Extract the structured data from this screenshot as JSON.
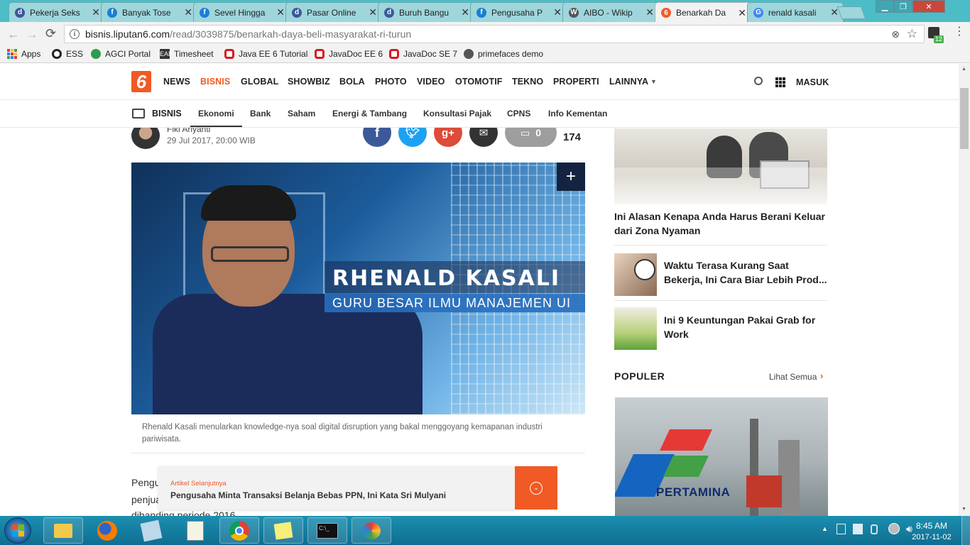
{
  "browser": {
    "tabs": [
      {
        "title": "Pekerja Seks",
        "fav": "d",
        "color": "#3b5998"
      },
      {
        "title": "Banyak Tose",
        "fav": "f",
        "color": "#1a7fd4"
      },
      {
        "title": "Sevel Hingga",
        "fav": "f",
        "color": "#1a7fd4"
      },
      {
        "title": "Pasar Online",
        "fav": "d",
        "color": "#3b5998"
      },
      {
        "title": "Buruh Bangu",
        "fav": "d",
        "color": "#3b5998"
      },
      {
        "title": "Pengusaha P",
        "fav": "f",
        "color": "#1a7fd4"
      },
      {
        "title": "AIBO - Wikip",
        "fav": "W",
        "color": "#555555"
      },
      {
        "title": "Benarkah Da",
        "fav": "6",
        "color": "#f15a24"
      },
      {
        "title": "renald kasali",
        "fav": "G",
        "color": "#4285f4"
      }
    ],
    "url_host": "bisnis.liputan6.com",
    "url_path": "/read/3039875/benarkah-daya-beli-masyarakat-ri-turun",
    "extension_badge": "12",
    "bookmarks": [
      {
        "label": "Apps",
        "icon": "apps-grid-icon"
      },
      {
        "label": "ESS",
        "icon": "ess-circle-icon"
      },
      {
        "label": "AGCI Portal",
        "icon": "agci-portal-icon"
      },
      {
        "label": "Timesheet",
        "icon": "timesheet-icon"
      },
      {
        "label": "Java EE 6 Tutorial",
        "icon": "oracle-icon"
      },
      {
        "label": "JavaDoc EE 6",
        "icon": "oracle-icon"
      },
      {
        "label": "JavaDoc SE 7",
        "icon": "oracle-icon"
      },
      {
        "label": "primefaces demo",
        "icon": "primefaces-icon"
      }
    ]
  },
  "site": {
    "logo": "6",
    "nav": [
      "NEWS",
      "BISNIS",
      "GLOBAL",
      "SHOWBIZ",
      "BOLA",
      "PHOTO",
      "VIDEO",
      "OTOMOTIF",
      "TEKNO",
      "PROPERTI",
      "LAINNYA"
    ],
    "active_nav": "BISNIS",
    "login": "MASUK",
    "section": "BISNIS",
    "subnav": [
      "Ekonomi",
      "Bank",
      "Saham",
      "Energi & Tambang",
      "Konsultasi Pajak",
      "CPNS",
      "Info Kementan"
    ],
    "active_subnav": "Ekonomi",
    "accent": "#f15a24"
  },
  "article": {
    "author": "Fiki Ariyanti",
    "date": "29 Jul 2017, 20:00 WIB",
    "comment_count": "0",
    "share_count": "174",
    "image_title": "RHENALD KASALI",
    "image_subtitle": "GURU BESAR ILMU MANAJEMEN UI",
    "caption": "Rhenald Kasali menularkan knowledge-nya soal digital disruption yang bakal menggoyang kemapanan industri pariwisata.",
    "body_line1": "Pengu",
    "body_line2": "penjua",
    "body_line3": "dibanding periode 2016",
    "next_label": "Artikel Selanjutnya",
    "next_title": "Pengusaha Minta Transaksi Belanja Bebas PPN, Ini Kata Sri Mulyani"
  },
  "sidebar": {
    "item1": "Ini Alasan Kenapa Anda Harus Berani Keluar dari Zona Nyaman",
    "item2": "Waktu Terasa Kurang Saat Bekerja, Ini Cara Biar Lebih Prod...",
    "item3": "Ini 9 Keuntungan Pakai Grab for Work",
    "populer": "POPULER",
    "see_all": "Lihat Semua",
    "pertamina": "PERTAMINA"
  },
  "taskbar": {
    "time": "8:45 AM",
    "date": "2017-11-02"
  }
}
